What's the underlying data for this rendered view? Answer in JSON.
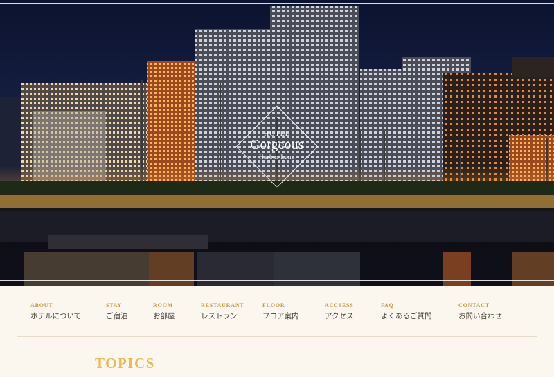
{
  "hero": {
    "logo": {
      "line1": "HOTEL",
      "line2": "Gorgeous",
      "line3": "Harbor Land"
    }
  },
  "nav": {
    "items": [
      {
        "en": "ABOUT",
        "ja": "ホテルについて"
      },
      {
        "en": "STAY",
        "ja": "ご宿泊"
      },
      {
        "en": "ROOM",
        "ja": "お部屋"
      },
      {
        "en": "RESTAURANT",
        "ja": "レストラン"
      },
      {
        "en": "FLOOR",
        "ja": "フロア案内"
      },
      {
        "en": "ACCSESS",
        "ja": "アクセス"
      },
      {
        "en": "FAQ",
        "ja": "よくあるご質問"
      },
      {
        "en": "CONTACT",
        "ja": "お問い合わせ"
      }
    ]
  },
  "section": {
    "title": "TOPICS"
  },
  "colors": {
    "accent": "#c79a3a",
    "title": "#e8bb55",
    "background": "#fcf7ee"
  }
}
